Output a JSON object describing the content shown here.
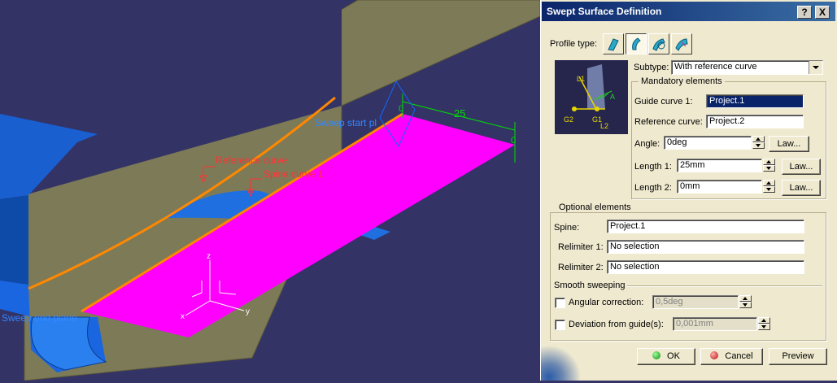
{
  "viewport": {
    "labels": {
      "reference_curve": "Reference curve",
      "spine_curve": "Spine curve 1",
      "sweep_start": "Sweep start pl",
      "sweep_end": "Sweep end plane",
      "dim_length": "25",
      "dim_zero": "0",
      "dim_zero2": "0",
      "axis_z": "z",
      "axis_y": "y",
      "axis_x": "x"
    },
    "colors": {
      "background": "#333366",
      "swept_surface": "#ff00ff",
      "orange_curve": "#ff8800",
      "solid_blue": "#1166dd",
      "wall": "#7d7a58"
    }
  },
  "dialog": {
    "title": "Swept Surface Definition",
    "help_button": "?",
    "close_button": "X",
    "profile_type_label": "Profile type:",
    "profile_icons": [
      "line-profile-icon",
      "circle-profile-icon",
      "conic-profile-icon",
      "explicit-profile-icon"
    ],
    "subtype_label": "Subtype:",
    "subtype_value": "With reference curve",
    "mandatory": {
      "title": "Mandatory elements",
      "guide_curve_1_label": "Guide curve 1:",
      "guide_curve_1_value": "Project.1",
      "reference_curve_label": "Reference curve:",
      "reference_curve_value": "Project.2",
      "angle_label": "Angle:",
      "angle_value": "0deg",
      "length1_label": "Length 1:",
      "length1_value": "25mm",
      "length2_label": "Length 2:",
      "length2_value": "0mm",
      "law_label": "Law..."
    },
    "diagram": {
      "l1": "L1",
      "l2": "L2",
      "g1": "G1",
      "g2": "G2",
      "a": "A"
    },
    "optional": {
      "title": "Optional elements",
      "spine_label": "Spine:",
      "spine_value": "Project.1",
      "relimiter1_label": "Relimiter 1:",
      "relimiter1_value": "No selection",
      "relimiter2_label": "Relimiter 2:",
      "relimiter2_value": "No selection"
    },
    "smooth": {
      "title": "Smooth sweeping",
      "angular_label": "Angular correction:",
      "angular_value": "0,5deg",
      "deviation_label": "Deviation from guide(s):",
      "deviation_value": "0,001mm"
    },
    "buttons": {
      "ok": "OK",
      "cancel": "Cancel",
      "preview": "Preview"
    }
  }
}
